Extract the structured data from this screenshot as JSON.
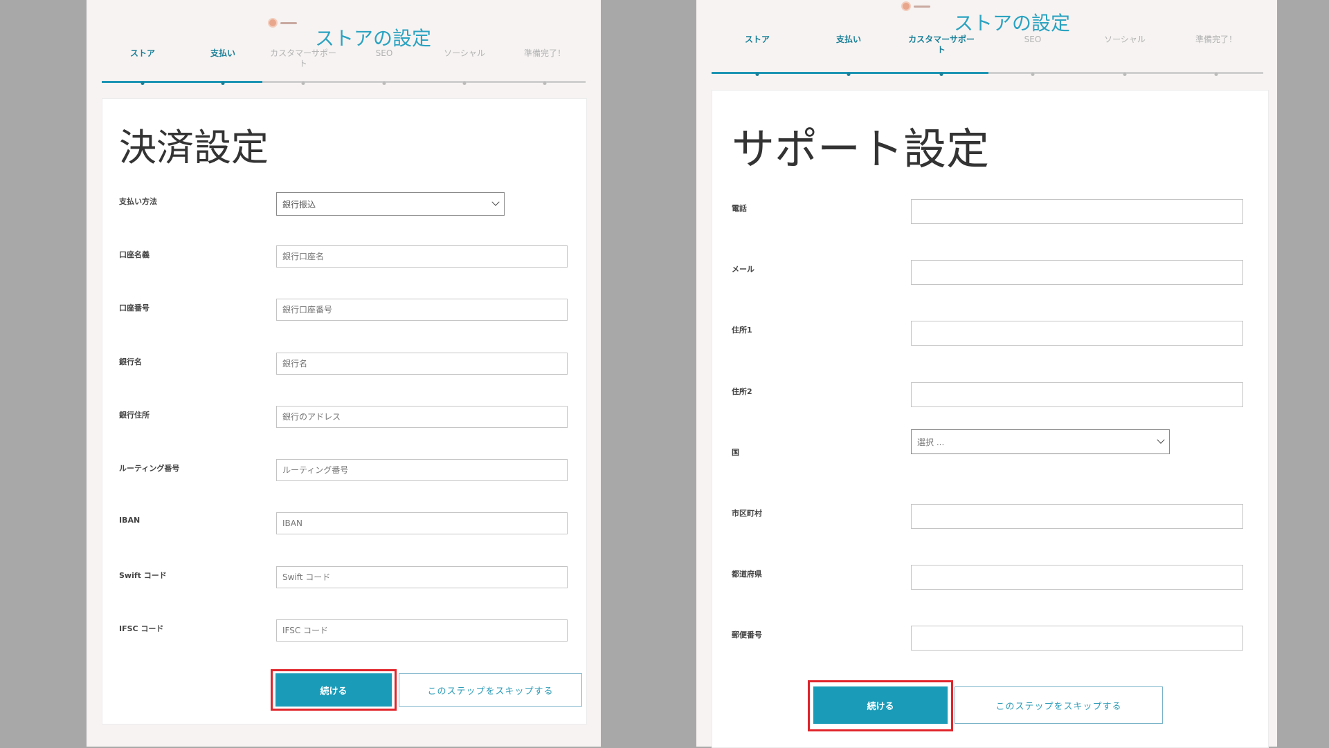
{
  "left": {
    "wizard_title": "ストアの設定",
    "steps": [
      "ストア",
      "支払い",
      "カスタマーサポー\nト",
      "SEO",
      "ソーシャル",
      "準備完了！"
    ],
    "page_title": "決済設定",
    "fields": [
      {
        "label": "支払い方法",
        "type": "select",
        "value": "銀行振込"
      },
      {
        "label": "口座名義",
        "placeholder": "銀行口座名"
      },
      {
        "label": "口座番号",
        "placeholder": "銀行口座番号"
      },
      {
        "label": "銀行名",
        "placeholder": "銀行名"
      },
      {
        "label": "銀行住所",
        "placeholder": "銀行のアドレス"
      },
      {
        "label": "ルーティング番号",
        "placeholder": "ルーティング番号"
      },
      {
        "label": "IBAN",
        "placeholder": "IBAN"
      },
      {
        "label": "Swift コード",
        "placeholder": "Swift コード"
      },
      {
        "label": "IFSC コード",
        "placeholder": "IFSC コード"
      }
    ],
    "continue_label": "続ける",
    "skip_label": "このステップをスキップする"
  },
  "right": {
    "wizard_title": "ストアの設定",
    "steps": [
      "ストア",
      "支払い",
      "カスタマーサポー\nト",
      "SEO",
      "ソーシャル",
      "準備完了！"
    ],
    "page_title": "サポート設定",
    "fields": [
      {
        "label": "電話",
        "value": ""
      },
      {
        "label": "メール",
        "value": ""
      },
      {
        "label": "住所1",
        "value": ""
      },
      {
        "label": "住所2",
        "value": ""
      },
      {
        "label": "国",
        "type": "select",
        "value": "選択 ..."
      },
      {
        "label": "市区町村",
        "value": ""
      },
      {
        "label": "都道府県",
        "value": ""
      },
      {
        "label": "郵便番号",
        "value": ""
      }
    ],
    "continue_label": "続ける",
    "skip_label": "このステップをスキップする"
  },
  "colors": {
    "accent": "#1a9bb8",
    "highlight": "#e0242a",
    "title": "#2ba3c1"
  },
  "icons": {
    "logo": "store-logo-icon",
    "select": "chevron-down-icon"
  }
}
